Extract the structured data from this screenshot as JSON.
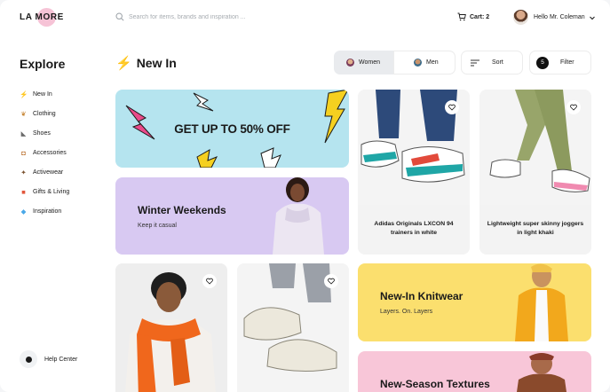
{
  "header": {
    "logo": "LA MORE",
    "search_placeholder": "Search for items, brands and inspiration ...",
    "cart_label": "Cart: 2",
    "user_greeting": "Hello",
    "user_name": "Mr. Coleman"
  },
  "sidebar": {
    "title": "Explore",
    "items": [
      {
        "label": "New In",
        "icon": "lightning-icon"
      },
      {
        "label": "Clothing",
        "icon": "clothing-icon"
      },
      {
        "label": "Shoes",
        "icon": "shoe-icon"
      },
      {
        "label": "Accessories",
        "icon": "bag-icon"
      },
      {
        "label": "Activewear",
        "icon": "activewear-icon"
      },
      {
        "label": "Gifts & Living",
        "icon": "gift-icon"
      },
      {
        "label": "Inspiration",
        "icon": "diamond-icon"
      }
    ],
    "help_label": "Help Center"
  },
  "main": {
    "title": "New In",
    "segments": {
      "women": "Women",
      "men": "Men",
      "selected": "Women"
    },
    "sort_label": "Sort",
    "filter_label": "Filter",
    "filter_count": "5"
  },
  "cards": {
    "sale": "GET UP TO 50% OFF",
    "winter_title": "Winter Weekends",
    "winter_sub": "Keep it casual",
    "product1": "Adidas Originals LXCON 94 trainers in white",
    "product2": "Lightweight super skinny joggers in light khaki",
    "knit_title": "New-In Knitwear",
    "knit_sub": "Layers. On. Layers",
    "textures_title": "New-Season Textures"
  },
  "colors": {
    "sale_bg": "#b5e4ef",
    "winter_bg": "#d8c9f2",
    "knit_bg": "#fbdf6e",
    "textures_bg": "#f8c6d8",
    "logo_accent": "#f6c3d6"
  }
}
